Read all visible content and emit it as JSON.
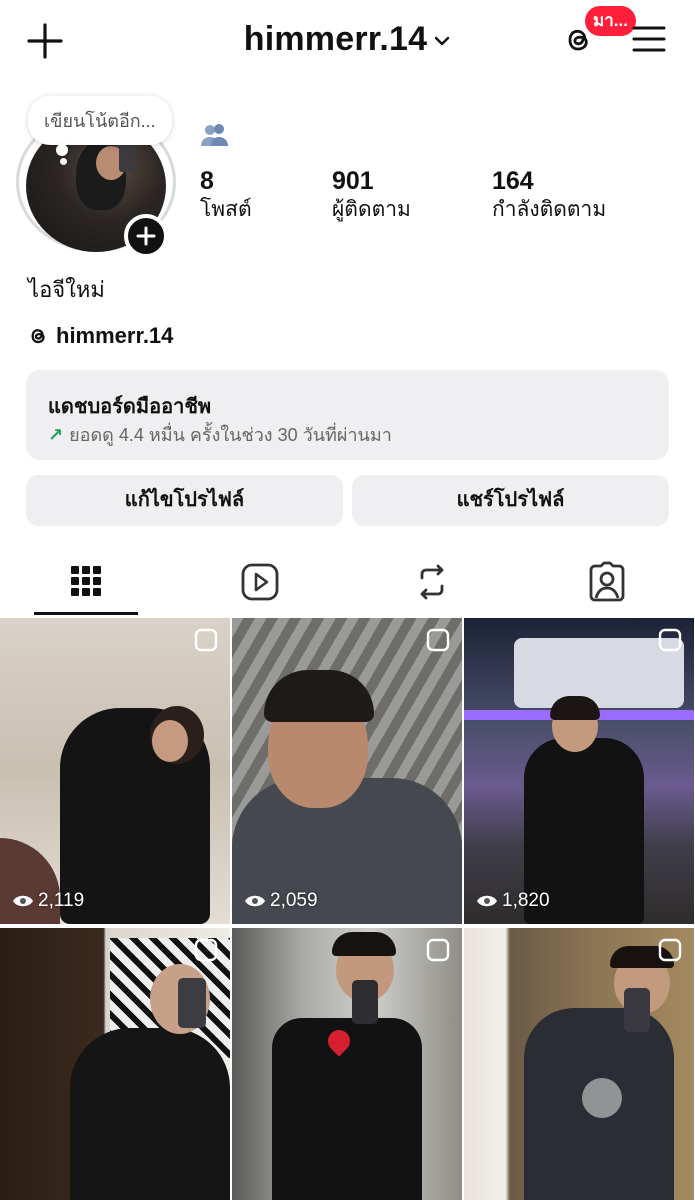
{
  "header": {
    "username": "himmerr.14",
    "badge_text": "มา...",
    "badge_color": "#ff1f3a"
  },
  "profile": {
    "note_placeholder": "เขียนโน้ตอีก...",
    "display_name": "ไอจีใหม่",
    "threads_handle": "himmerr.14",
    "stats": [
      {
        "value": "8",
        "label": "โพสต์"
      },
      {
        "value": "901",
        "label": "ผู้ติดตาม"
      },
      {
        "value": "164",
        "label": "กำลังติดตาม"
      }
    ]
  },
  "dashboard": {
    "title": "แดชบอร์ดมืออาชีพ",
    "subtitle": "ยอดดู 4.4 หมื่น ครั้งในช่วง 30 วันที่ผ่านมา",
    "arrow": "↗"
  },
  "buttons": {
    "edit_profile": "แก้ไขโปรไฟล์",
    "share_profile": "แชร์โปรไฟล์"
  },
  "tabs": [
    {
      "icon": "grid-icon",
      "active": true
    },
    {
      "icon": "reels-icon",
      "active": false
    },
    {
      "icon": "reposts-icon",
      "active": false
    },
    {
      "icon": "tagged-icon",
      "active": false
    }
  ],
  "posts": [
    {
      "views": "2,119"
    },
    {
      "views": "2,059"
    },
    {
      "views": "1,820"
    },
    {
      "views": ""
    },
    {
      "views": ""
    },
    {
      "views": ""
    }
  ]
}
